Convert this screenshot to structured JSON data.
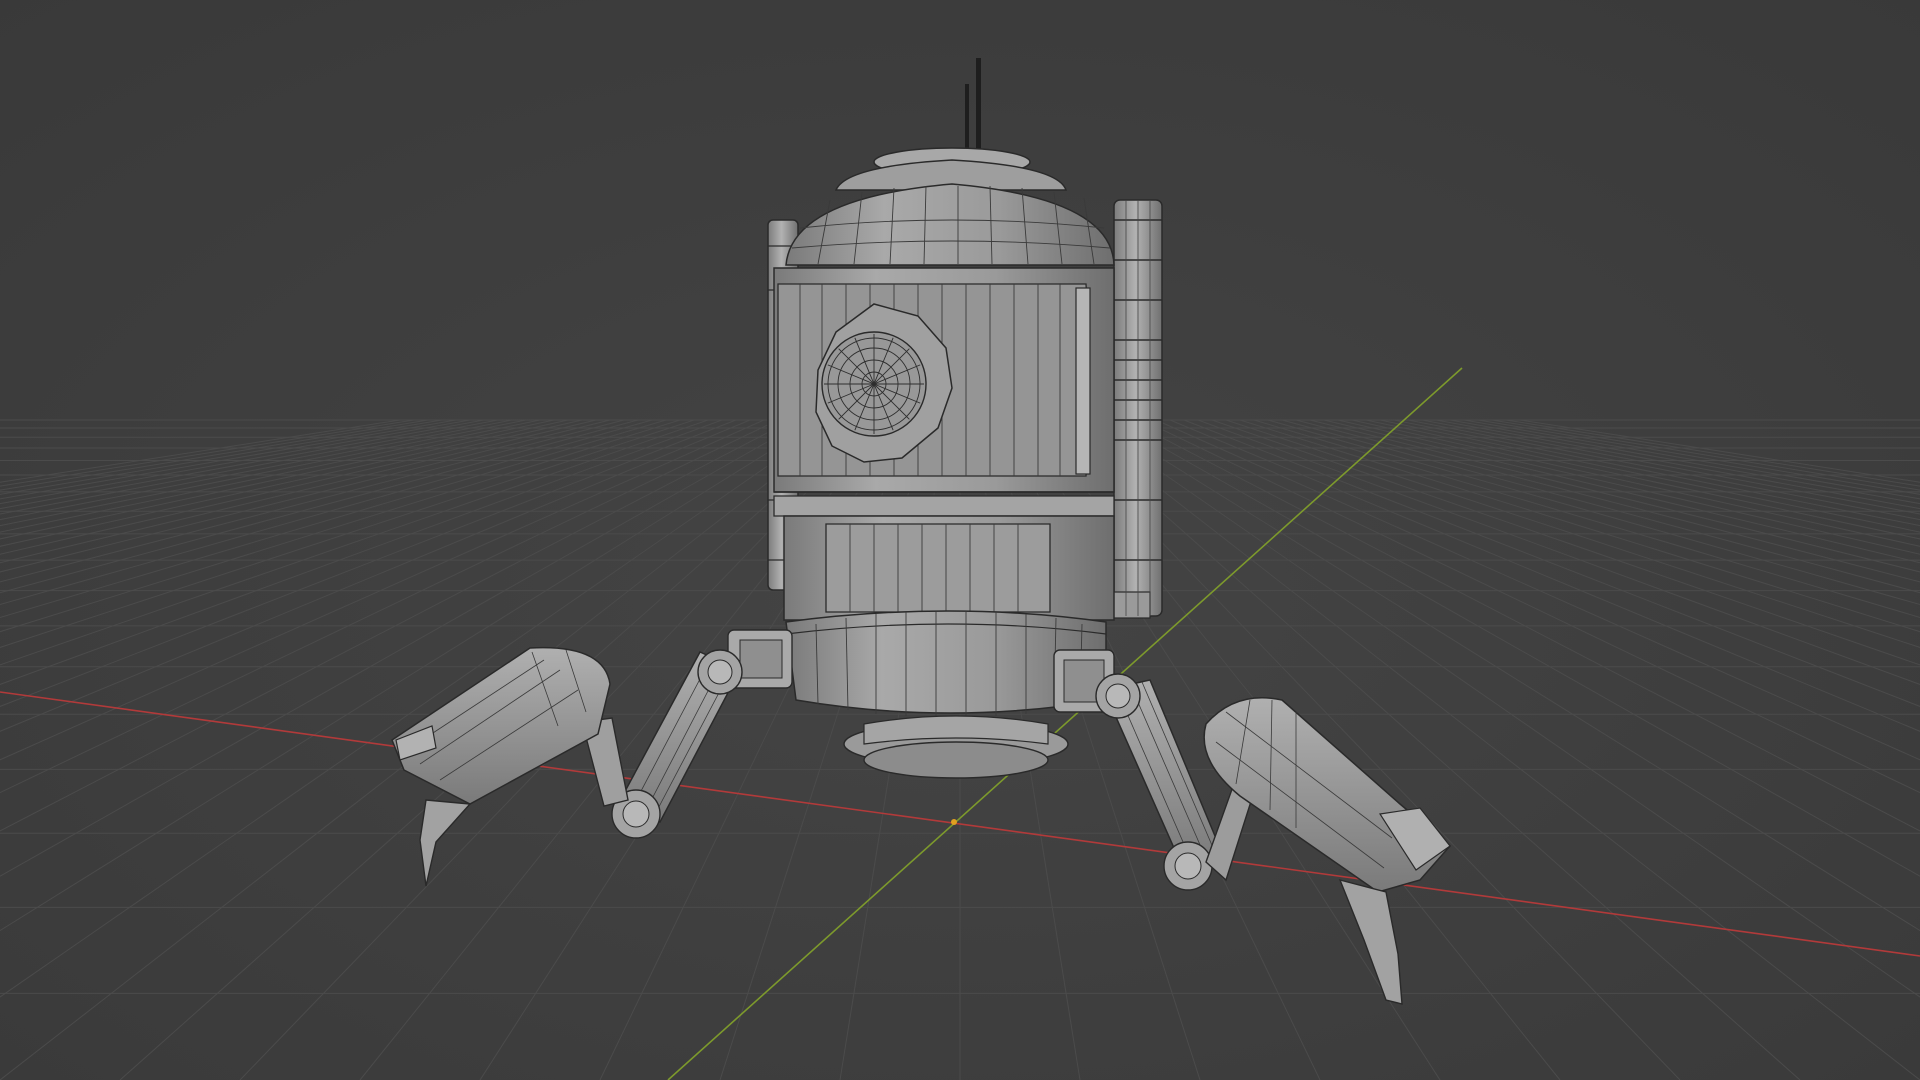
{
  "viewport": {
    "mode": "wireframe-on-solid",
    "view": "perspective"
  },
  "colors": {
    "background": "#3d3d3d",
    "grid_line": "#4b4b4b",
    "x_axis": "#b23a3a",
    "y_axis": "#7d9a2c",
    "model_fill": "#8e8e8e",
    "model_light": "#a6a6a6",
    "model_dark": "#6a6a6a",
    "wire": "#2a2a2a",
    "origin": "#e0a020"
  },
  "scene": {
    "object": "spider-droid-model",
    "parts": [
      "antenna",
      "dome-cap",
      "body-upper",
      "porthole",
      "side-pipe-left",
      "side-pipe-right",
      "body-mid",
      "body-lower",
      "base-disc",
      "leg-front-left",
      "leg-back-left",
      "leg-front-right",
      "leg-back-right"
    ]
  }
}
